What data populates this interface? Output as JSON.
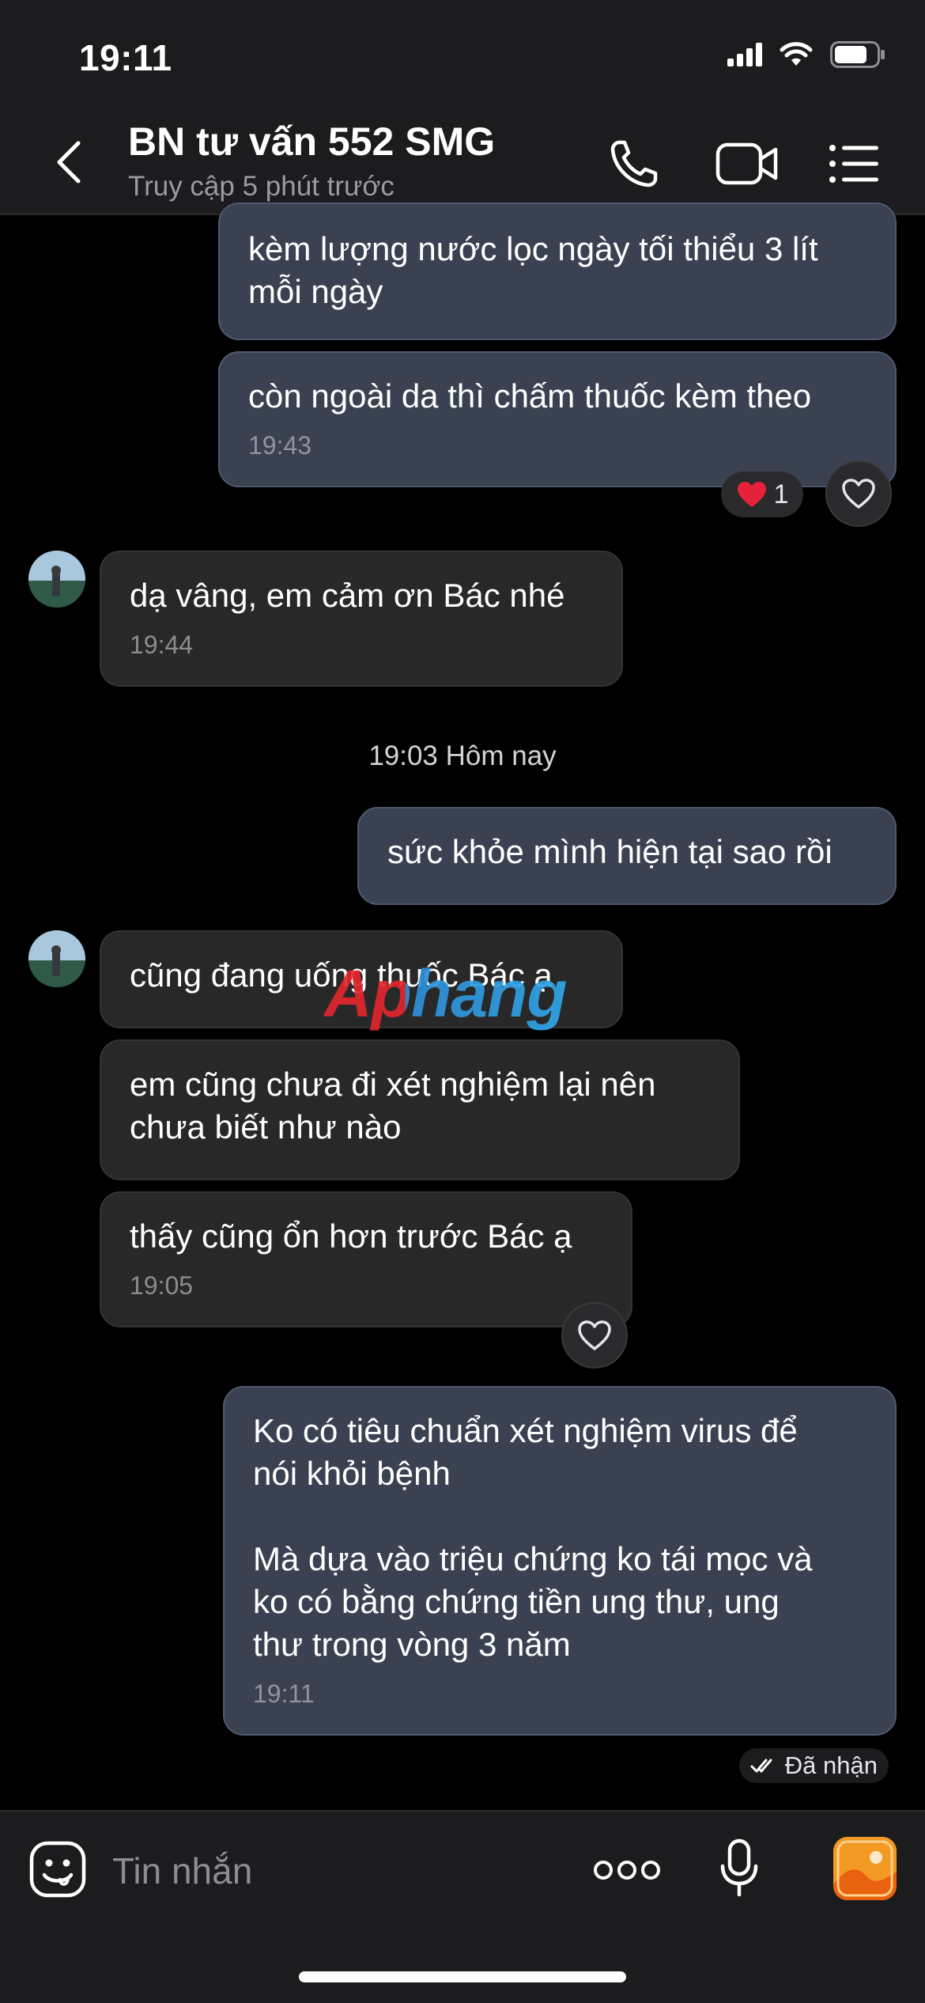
{
  "status_bar": {
    "time": "19:11"
  },
  "header": {
    "title": "BN tư vấn 552 SMG",
    "subtitle": "Truy cập 5 phút trước"
  },
  "messages": [
    {
      "text": "kèm lượng nước lọc ngày tối thiểu 3 lít\nmỗi ngày",
      "time": ""
    },
    {
      "text": "còn ngoài da thì chấm thuốc kèm theo",
      "time": "19:43",
      "reaction": {
        "emoji": "❤️",
        "count": "1"
      }
    },
    {
      "text": "dạ vâng, em cảm ơn Bác nhé",
      "time": "19:44"
    },
    {
      "text": "sức khỏe mình hiện tại sao rồi",
      "time": ""
    },
    {
      "text": "cũng đang uống thuốc Bác ạ",
      "time": ""
    },
    {
      "text": "em cũng chưa đi xét nghiệm lại nên\nchưa biết như nào",
      "time": ""
    },
    {
      "text": "thấy cũng ổn hơn trước Bác ạ",
      "time": "19:05"
    },
    {
      "text": "Ko có tiêu chuẩn xét nghiệm virus để\nnói khỏi bệnh\n\nMà dựa vào triệu chứng ko tái mọc và\nko có bằng chứng tiền ung thư, ung\nthư trong vòng 3 năm",
      "time": "19:11"
    }
  ],
  "day_separator": "19:03 Hôm nay",
  "delivery_status": "Đã nhận",
  "watermark": "Aphang",
  "composer": {
    "placeholder": "Tin nhắn"
  },
  "icons": [
    "back-arrow-icon",
    "phone-icon",
    "video-icon",
    "menu-list-icon",
    "heart-icon",
    "emoji-icon",
    "more-dots-icon",
    "microphone-icon",
    "gallery-icon",
    "double-check-icon"
  ],
  "colors": {
    "outgoing_bubble": "#3a4252",
    "incoming_bubble": "#282829",
    "bar_bg": "#1c1c1e",
    "accent_orange": "#f7a531"
  }
}
